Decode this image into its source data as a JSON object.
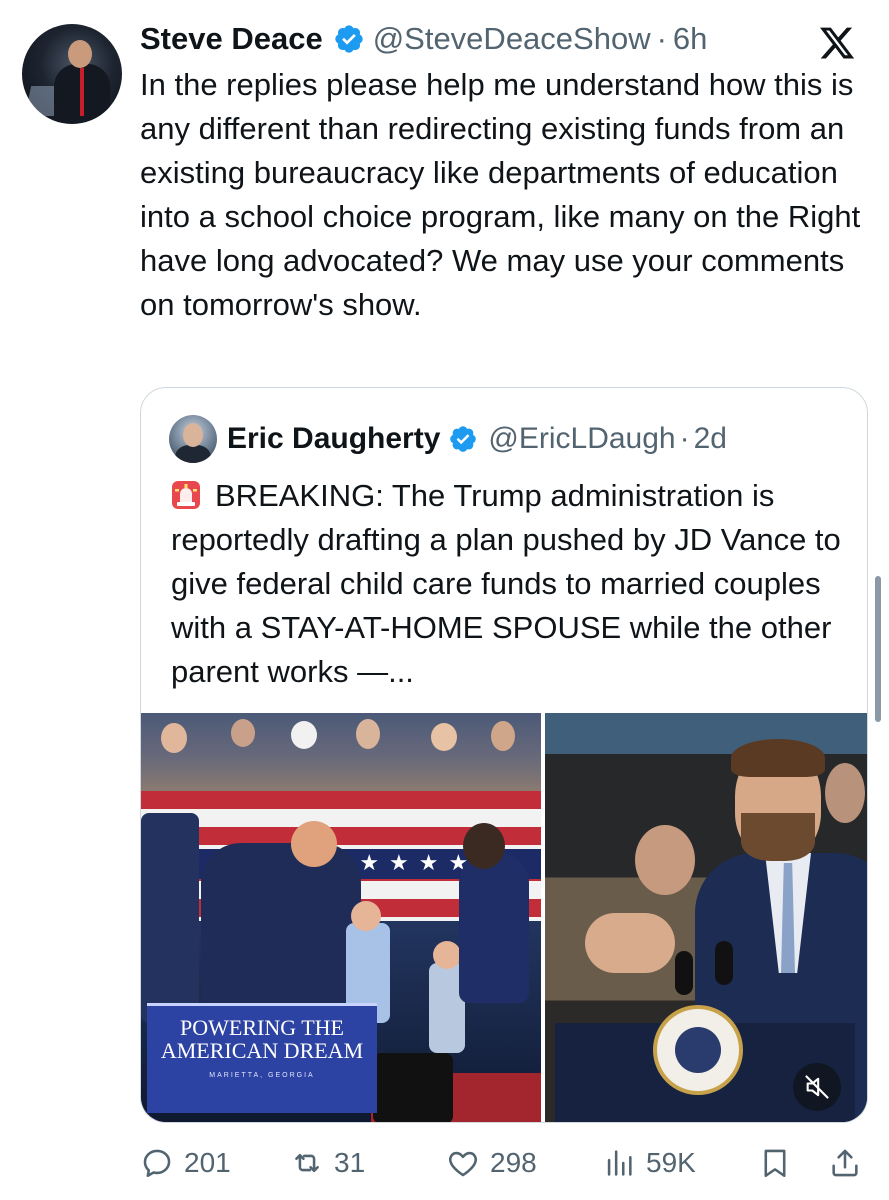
{
  "tweet": {
    "author_name": "Steve Deace",
    "handle": "@SteveDeaceShow",
    "separator": "·",
    "time": "6h",
    "text": "In the replies please help me understand how this is any different than redirecting existing funds from an existing bureaucracy like departments of education into a school choice program, like many on the Right have long advocated? We may use your comments on tomorrow's show."
  },
  "quoted_tweet": {
    "author_name": "Eric Daugherty",
    "handle": "@EricLDaugh",
    "separator": "·",
    "time": "2d",
    "emoji_icon": "police-siren-icon",
    "text": "BREAKING: The Trump administration is reportedly drafting a plan pushed by JD Vance to give federal child care funds to married couples with a STAY-AT-HOME SPOUSE while the other parent works —...",
    "media": {
      "left_sign_line1": "POWERING THE",
      "left_sign_line2": "AMERICAN DREAM",
      "left_sign_location": "MARIETTA, GEORGIA"
    }
  },
  "actions": {
    "replies": "201",
    "reposts": "31",
    "likes": "298",
    "views": "59K"
  },
  "colors": {
    "text": "#0f1419",
    "secondary": "#536471",
    "verified": "#1d9bf0",
    "border": "#cfd9de"
  }
}
